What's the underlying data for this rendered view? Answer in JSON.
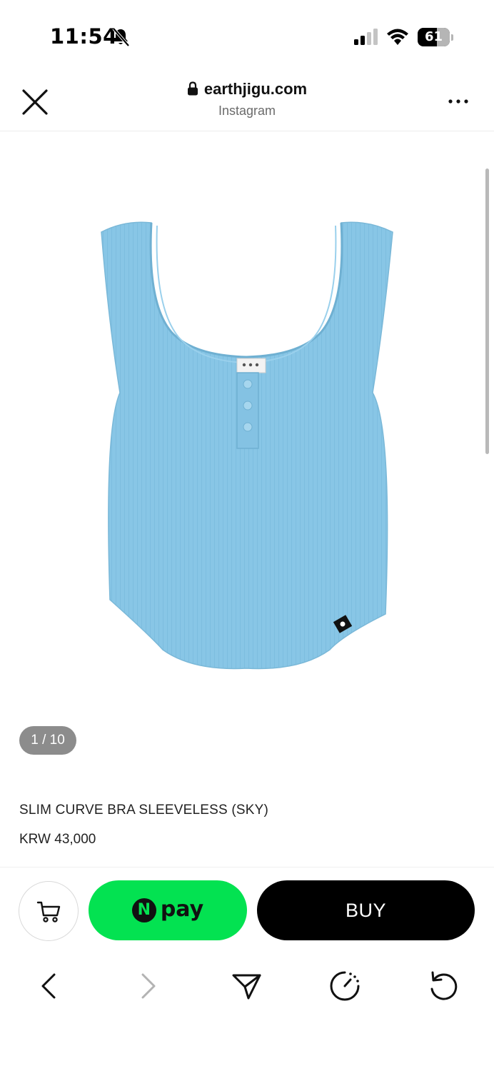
{
  "status_bar": {
    "time": "11:54",
    "battery_level": "61",
    "battery_fraction": 0.61,
    "icons": [
      "bell-slash-icon",
      "cellular-signal-icon",
      "wifi-icon",
      "battery-icon"
    ]
  },
  "browser": {
    "url": "earthjigu.com",
    "source": "Instagram",
    "icons": [
      "close-icon",
      "lock-icon",
      "more-icon"
    ]
  },
  "gallery": {
    "pager": "1 / 10",
    "image_alt": "sky blue ribbed sleeveless tank top"
  },
  "product": {
    "title": "SLIM CURVE BRA SLEEVELESS (SKY)",
    "price": "KRW 43,000"
  },
  "purchase": {
    "npay_mark": "N",
    "npay_label": "pay",
    "buy_label": "BUY",
    "colors": {
      "npay": "#03e251",
      "buy": "#000000",
      "product": "#88c6e6"
    }
  },
  "nav": {
    "icons": [
      "back-icon",
      "forward-icon",
      "share-icon",
      "speed-dial-icon",
      "reload-icon"
    ]
  }
}
